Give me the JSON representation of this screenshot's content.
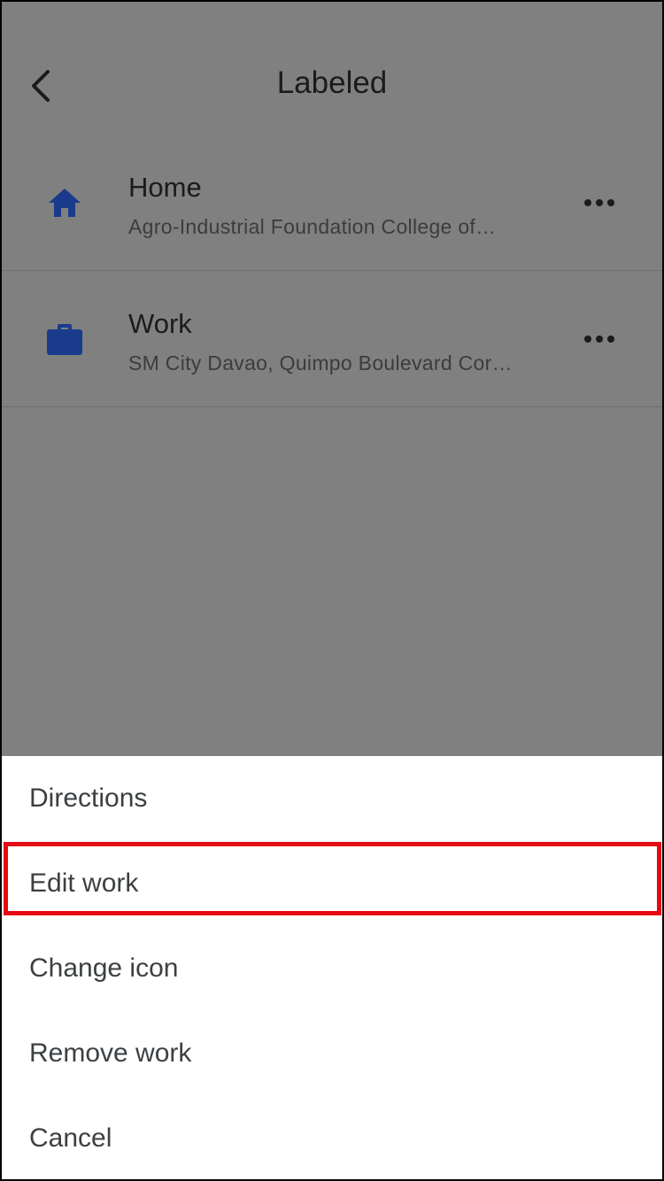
{
  "header": {
    "title": "Labeled"
  },
  "places": [
    {
      "label": "Home",
      "address": "Agro-Industrial Foundation College of…",
      "icon": "home-icon"
    },
    {
      "label": "Work",
      "address": "SM City Davao, Quimpo Boulevard Cor…",
      "icon": "briefcase-icon"
    }
  ],
  "action_sheet": {
    "items": [
      "Directions",
      "Edit work",
      "Change icon",
      "Remove work",
      "Cancel"
    ],
    "highlighted": "Edit work"
  },
  "colors": {
    "overlay": "#808080",
    "icon_blue": "#1a3a8c",
    "highlight_red": "#e50914"
  }
}
